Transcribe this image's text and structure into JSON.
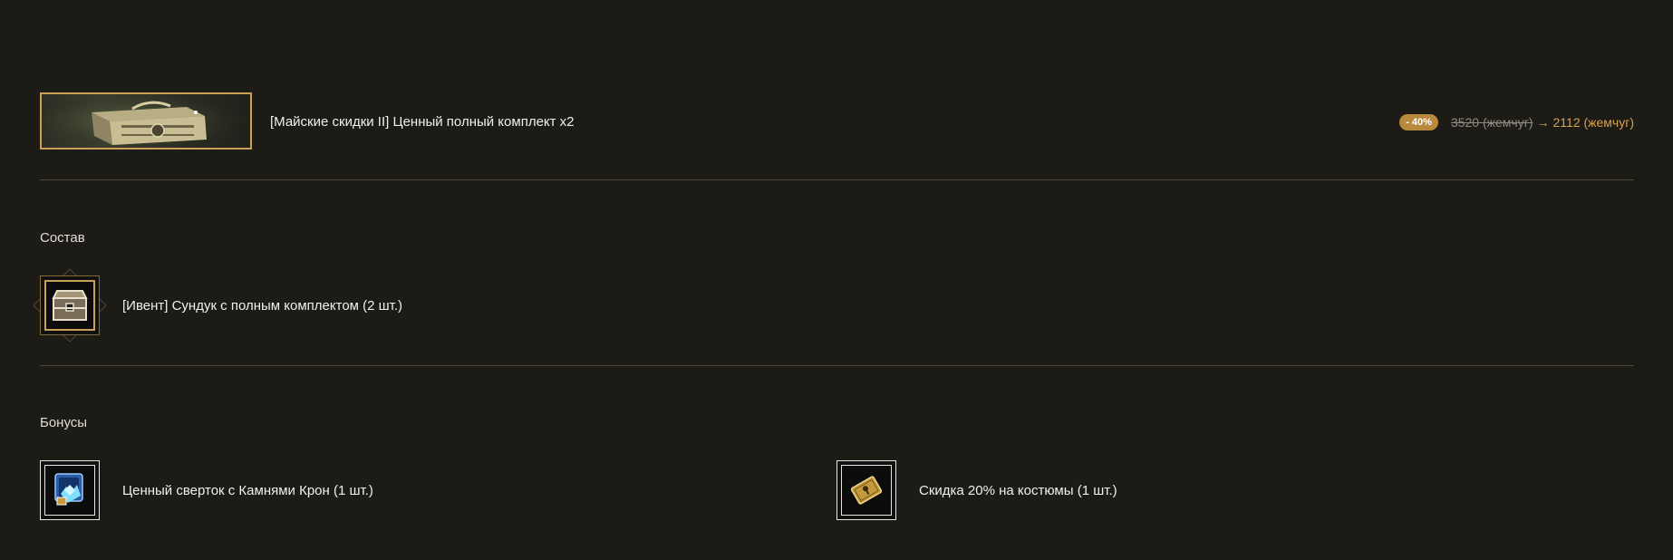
{
  "product": {
    "name": "[Майские скидки II] Ценный полный комплект x2",
    "thumbnail_icon": "ornate-chest",
    "discount_badge": "- 40%",
    "old_price": "3520 (жемчуг)",
    "arrow": "→",
    "new_price": "2112 (жемчуг)"
  },
  "composition": {
    "title": "Состав",
    "items": [
      {
        "label": "[Ивент] Сундук с полным комплектом (2 шт.)",
        "icon": "chest-icon"
      }
    ]
  },
  "bonuses": {
    "title": "Бонусы",
    "items": [
      {
        "label": "Ценный сверток с Камнями Крон (1 шт.)",
        "icon": "gem-box-icon"
      },
      {
        "label": "Скидка 20% на костюмы (1 шт.)",
        "icon": "coupon-icon"
      }
    ]
  },
  "colors": {
    "background": "#1c1b16",
    "accent_gold": "#d9a24e",
    "badge": "#b88a3e",
    "divider": "#4a4839"
  }
}
